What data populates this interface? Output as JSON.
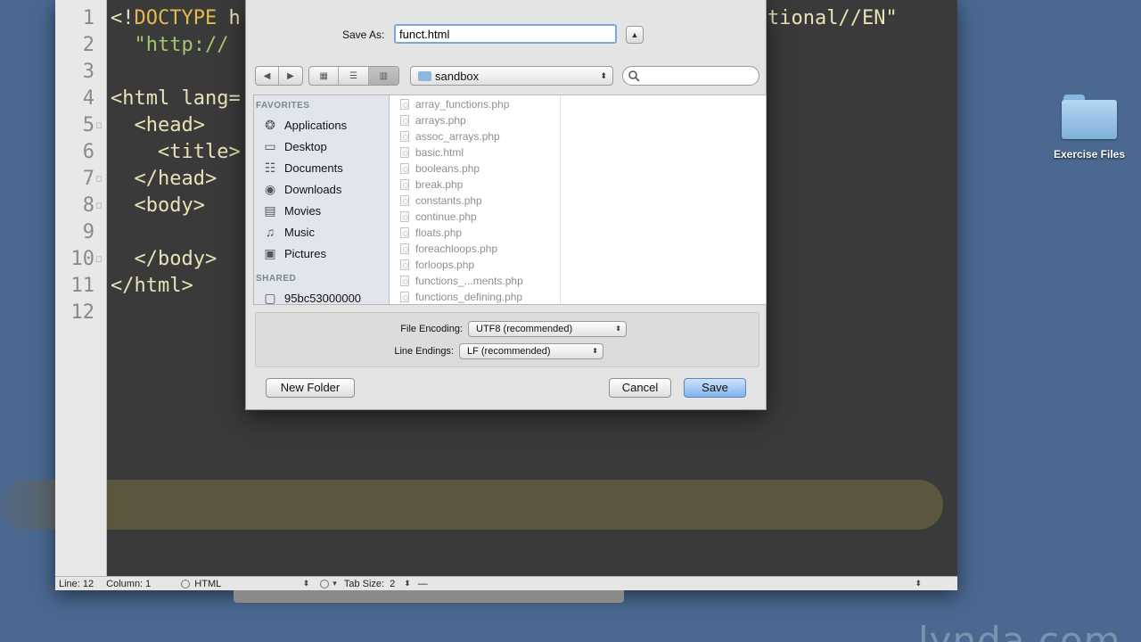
{
  "editor": {
    "line_numbers": [
      "1",
      "2",
      "3",
      "4",
      "5",
      "6",
      "7",
      "8",
      "9",
      "10",
      "11",
      "12"
    ],
    "code_lines": [
      [
        {
          "t": "<!",
          "c": "tag"
        },
        {
          "t": "DOCTYPE",
          "c": "kw"
        },
        {
          "t": " h",
          "c": "tag"
        }
      ],
      [
        {
          "t": "  \"http://",
          "c": "str"
        }
      ],
      [],
      [
        {
          "t": "<html lang=",
          "c": "tag"
        }
      ],
      [
        {
          "t": "  <head>",
          "c": "tag"
        }
      ],
      [
        {
          "t": "    <title>",
          "c": "tag"
        }
      ],
      [
        {
          "t": "  </head>",
          "c": "tag"
        }
      ],
      [
        {
          "t": "  <body>",
          "c": "tag"
        }
      ],
      [],
      [
        {
          "t": "  </body>",
          "c": "tag"
        }
      ],
      [
        {
          "t": "</html>",
          "c": "tag"
        }
      ],
      []
    ],
    "doctype_tail": "tional//EN\"",
    "statusbar": {
      "line": "Line: 12",
      "column": "Column: 1",
      "language": "HTML",
      "tab_size_label": "Tab Size:",
      "tab_size_value": "2",
      "symbol": "—"
    }
  },
  "dialog": {
    "save_as_label": "Save As:",
    "filename": "funct.html",
    "location": "sandbox",
    "search_placeholder": "",
    "sidebar": {
      "favorites_heading": "FAVORITES",
      "favorites": [
        {
          "label": "Applications",
          "icon": "applications-icon"
        },
        {
          "label": "Desktop",
          "icon": "desktop-icon"
        },
        {
          "label": "Documents",
          "icon": "documents-icon"
        },
        {
          "label": "Downloads",
          "icon": "downloads-icon"
        },
        {
          "label": "Movies",
          "icon": "movies-icon"
        },
        {
          "label": "Music",
          "icon": "music-icon"
        },
        {
          "label": "Pictures",
          "icon": "pictures-icon"
        }
      ],
      "shared_heading": "SHARED",
      "shared": [
        {
          "label": "95bc53000000",
          "icon": "network-computer-icon"
        }
      ]
    },
    "files": [
      "array_functions.php",
      "arrays.php",
      "assoc_arrays.php",
      "basic.html",
      "booleans.php",
      "break.php",
      "constants.php",
      "continue.php",
      "floats.php",
      "foreachloops.php",
      "forloops.php",
      "functions_...ments.php",
      "functions_defining.php"
    ],
    "file_encoding_label": "File Encoding:",
    "file_encoding_value": "UTF8 (recommended)",
    "line_endings_label": "Line Endings:",
    "line_endings_value": "LF (recommended)",
    "new_folder_label": "New Folder",
    "cancel_label": "Cancel",
    "save_label": "Save"
  },
  "desktop": {
    "folder_label": "Exercise Files",
    "watermark": "lynda.com"
  },
  "colors": {
    "desktop_bg": "#4a6890",
    "editor_bg": "#3a3a3a",
    "tag": "#e8e2b7",
    "keyword": "#e6b94e",
    "string": "#a3c76d",
    "accent_button": "#7fb2ec"
  }
}
